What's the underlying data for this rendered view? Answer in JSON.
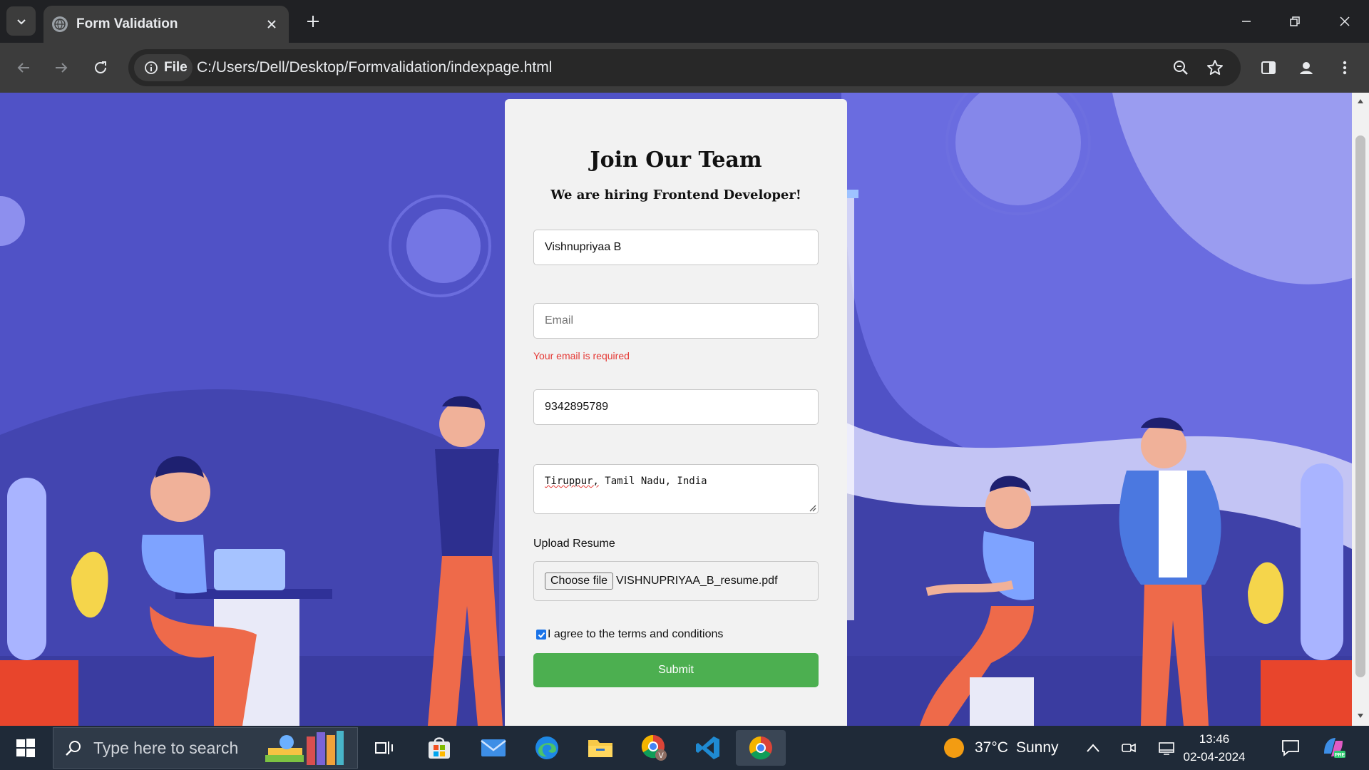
{
  "browser": {
    "tab_title": "Form Validation",
    "chip_label": "File",
    "url": "C:/Users/Dell/Desktop/Formvalidation/indexpage.html"
  },
  "form": {
    "title": "Join Our Team",
    "subtitle": "We are hiring Frontend Developer!",
    "name_value": "Vishnupriyaa B",
    "email_placeholder": "Email",
    "email_error": "Your email is required",
    "phone_value": "9342895789",
    "address_word1": "Tiruppur,",
    "address_rest": " Tamil Nadu, India",
    "upload_label": "Upload Resume",
    "choose_file_label": "Choose file",
    "file_name": "VISHNUPRIYAA_B_resume.pdf",
    "agree_label": "I agree to the terms and conditions",
    "agree_checked": true,
    "submit_label": "Submit"
  },
  "taskbar": {
    "search_placeholder": "Type here to search",
    "temperature": "37°C",
    "weather": "Sunny",
    "time": "13:46",
    "date": "02-04-2024"
  },
  "colors": {
    "accent_submit": "#4caf50",
    "error": "#e53935",
    "background_illustration": "#4f51c4"
  }
}
